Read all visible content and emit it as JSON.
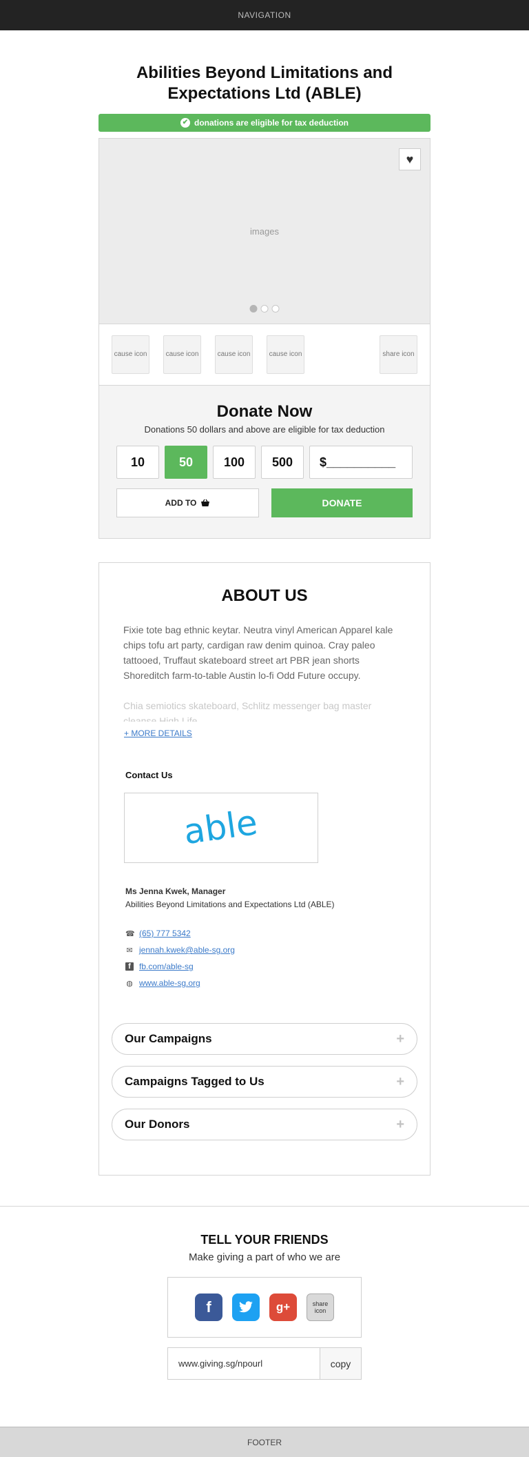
{
  "nav": {
    "label": "NAVIGATION"
  },
  "org": {
    "title": "Abilities Beyond Limitations and Expectations Ltd (ABLE)"
  },
  "tax_bar": {
    "text": "donations are eligible for tax deduction",
    "color": "#5cb85c"
  },
  "gallery": {
    "placeholder": "images",
    "slides": 3,
    "active_slide": 1
  },
  "icons_row": {
    "cause_label": "cause icon",
    "share_label": "share icon"
  },
  "donate": {
    "heading": "Donate Now",
    "sub": "Donations 50 dollars  and above are eligible for tax deduction",
    "amounts": [
      "10",
      "50",
      "100",
      "500"
    ],
    "selected_amount": "50",
    "custom_placeholder": "$__________",
    "add_to_label": "ADD TO",
    "donate_label": "DONATE"
  },
  "about": {
    "heading": "ABOUT US",
    "para1": "Fixie tote bag ethnic keytar. Neutra vinyl American Apparel kale chips tofu art party, cardigan raw denim quinoa. Cray paleo tattooed, Truffaut skateboard street art PBR jean shorts Shoreditch farm-to-table Austin lo-fi Odd Future occupy.",
    "para2": "Chia semiotics skateboard, Schlitz messenger bag master cleanse High Life",
    "more_label": "+ MORE DETAILS",
    "contact_heading": "Contact Us",
    "logo_text": "able",
    "person_name": "Ms Jenna Kwek, Manager",
    "person_org": "Abilities Beyond Limitations and Expectations Ltd (ABLE)",
    "phone": "(65) 777 5342",
    "email": "jennah.kwek@able-sg.org",
    "facebook": "fb.com/able-sg",
    "website": "www.able-sg.org"
  },
  "accordion": [
    "Our Campaigns",
    "Campaigns Tagged to Us",
    "Our Donors"
  ],
  "share": {
    "heading": "TELL YOUR FRIENDS",
    "sub": "Make giving a part of who we are",
    "share_icon_label": "share icon",
    "url": "www.giving.sg/npourl",
    "copy_label": "copy"
  },
  "footer": {
    "label": "FOOTER"
  }
}
